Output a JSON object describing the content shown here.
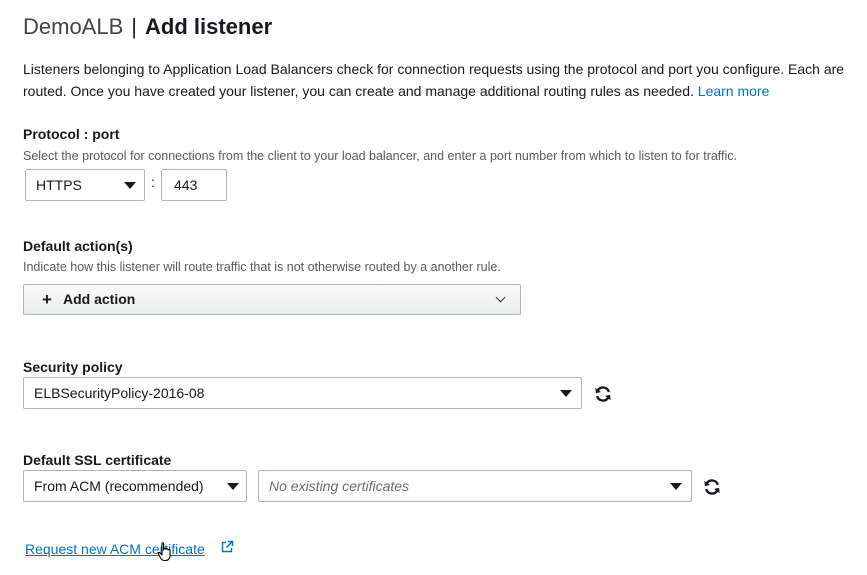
{
  "header": {
    "lb_name": "DemoALB",
    "separator": "|",
    "title": "Add listener"
  },
  "intro": {
    "text": "Listeners belonging to Application Load Balancers check for connection requests using the protocol and port you configure. Each are routed. Once you have created your listener, you can create and manage additional routing rules as needed.",
    "learn_more": "Learn more"
  },
  "protocol_port": {
    "label": "Protocol : port",
    "hint": "Select the protocol for connections from the client to your load balancer, and enter a port number from which to listen to for traffic.",
    "protocol_value": "HTTPS",
    "colon": ":",
    "port_value": "443"
  },
  "default_actions": {
    "label": "Default action(s)",
    "hint": "Indicate how this listener will route traffic that is not otherwise routed by a another rule.",
    "plus": "+",
    "add_action_label": "Add action"
  },
  "security_policy": {
    "label": "Security policy",
    "value": "ELBSecurityPolicy-2016-08"
  },
  "ssl_certificate": {
    "label": "Default SSL certificate",
    "source_value": "From ACM (recommended)",
    "certificate_placeholder": "No existing certificates",
    "request_link": "Request new ACM certificate"
  },
  "icons": {
    "dropdown": "caret-down-icon",
    "refresh": "refresh-icon",
    "external": "external-link-icon",
    "expand": "chevron-down-icon",
    "pointer": "hand-pointer-icon"
  },
  "colors": {
    "link": "#0073bb",
    "border": "#aab7b8",
    "hint_text": "#545b64"
  }
}
